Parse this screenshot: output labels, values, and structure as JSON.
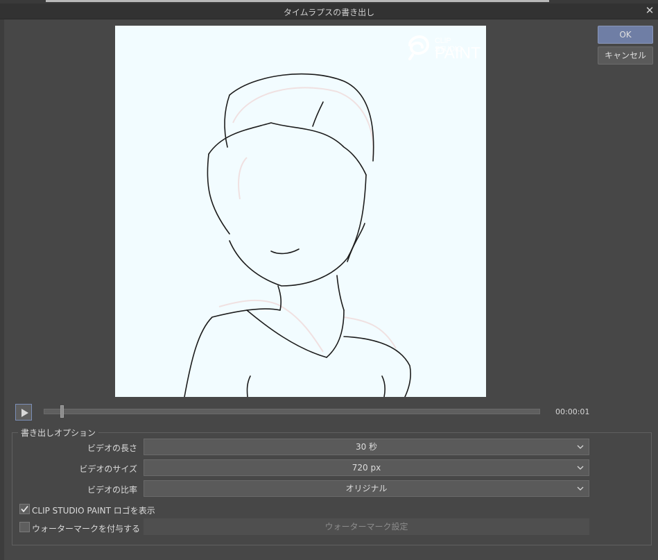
{
  "window": {
    "title": "タイムラプスの書き出し",
    "close_glyph": "✕"
  },
  "logo": {
    "line1": "CLIP STUDIO",
    "line2": "PAINT"
  },
  "buttons": {
    "ok": "OK",
    "cancel": "キャンセル"
  },
  "playback": {
    "time": "00:00:01",
    "progress_percent": 4
  },
  "options": {
    "group_title": "書き出しオプション",
    "length": {
      "label": "ビデオの長さ",
      "value": "30 秒"
    },
    "size": {
      "label": "ビデオのサイズ",
      "value": "720 px"
    },
    "ratio": {
      "label": "ビデオの比率",
      "value": "オリジナル"
    },
    "show_logo": {
      "label": "CLIP STUDIO PAINT ロゴを表示",
      "checked": true
    },
    "watermark": {
      "label": "ウォーターマークを付与する",
      "checked": false
    },
    "watermark_settings": "ウォーターマーク設定"
  },
  "colors": {
    "accent": "#6f7ea5",
    "background": "#474747",
    "preview_bg": "#f2fcff"
  },
  "icons": {
    "play": "play-icon",
    "close": "close-icon",
    "chevron": "chevron-down-icon",
    "check": "checkmark-icon"
  }
}
